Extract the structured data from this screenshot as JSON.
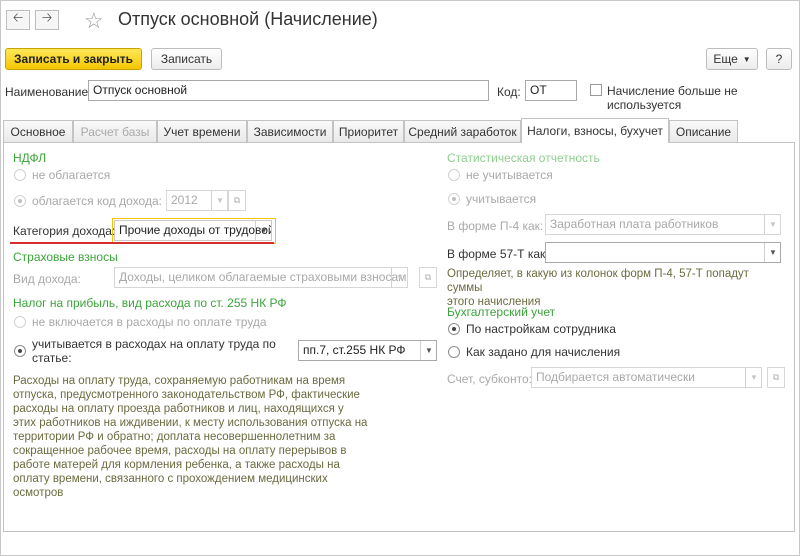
{
  "window": {
    "title": "Отпуск основной (Начисление)"
  },
  "toolbar": {
    "save_close": "Записать и закрыть",
    "save": "Записать",
    "more": "Еще",
    "help": "?"
  },
  "header": {
    "name_label": "Наименование:",
    "name_value": "Отпуск основной",
    "code_label": "Код:",
    "code_value": "ОТ",
    "unused_line1": "Начисление больше не",
    "unused_line2": "используется"
  },
  "tabs": [
    {
      "label": "Основное"
    },
    {
      "label": "Расчет базы"
    },
    {
      "label": "Учет времени"
    },
    {
      "label": "Зависимости"
    },
    {
      "label": "Приоритет"
    },
    {
      "label": "Средний заработок"
    },
    {
      "label": "Налоги, взносы, бухучет"
    },
    {
      "label": "Описание"
    }
  ],
  "left": {
    "ndfl_title": "НДФЛ",
    "ndfl_not_taxed": "не облагается",
    "ndfl_taxed": "облагается",
    "income_code_label": "код дохода:",
    "income_code_value": "2012",
    "income_category_label": "Категория дохода:",
    "income_category_value": "Прочие доходы от трудовой",
    "insurance_title": "Страховые взносы",
    "income_type_label": "Вид дохода:",
    "income_type_value": "Доходы, целиком облагаемые страховыми взносами",
    "profit_tax_title": "Налог на прибыль, вид расхода по ст. 255 НК РФ",
    "profit_not_included": "не включается в расходы по оплате труда",
    "profit_included_line1": "учитывается в расходах на оплату труда по",
    "profit_included_line2": "статье:",
    "article_value": "пп.7, ст.255 НК РФ",
    "note_lines": [
      "Расходы на оплату труда, сохраняемую работникам на время",
      "отпуска, предусмотренного законодательством РФ, фактические",
      "расходы на оплату проезда работников и лиц, находящихся у",
      "этих работников на иждивении, к месту использования отпуска на",
      "территории РФ и обратно; доплата несовершеннолетним за",
      "сокращенное рабочее время, расходы на оплату перерывов в",
      "работе матерей для кормления ребенка, а также расходы на",
      "оплату времени, связанного с прохождением медицинских",
      "осмотров"
    ]
  },
  "right": {
    "stat_title": "Статистическая отчетность",
    "stat_not_counted": "не учитывается",
    "stat_counted": "учитывается",
    "p4_label": "В форме П-4 как:",
    "p4_value": "Заработная плата работников",
    "f57_label": "В форме 57-Т как:",
    "f57_value": "",
    "f57_note_line1": "Определяет, в какую из колонок форм П-4, 57-Т попадут суммы",
    "f57_note_line2": "этого начисления",
    "acc_title": "Бухгалтерский учет",
    "acc_by_employee": "По настройкам сотрудника",
    "acc_as_set": "Как задано для начисления",
    "account_label": "Счет, субконто:",
    "account_placeholder": "Подбирается автоматически"
  },
  "colors": {
    "accent_yellow": "#f3c600",
    "section_green": "#3ba43b",
    "highlight_red": "#d42e2e"
  }
}
